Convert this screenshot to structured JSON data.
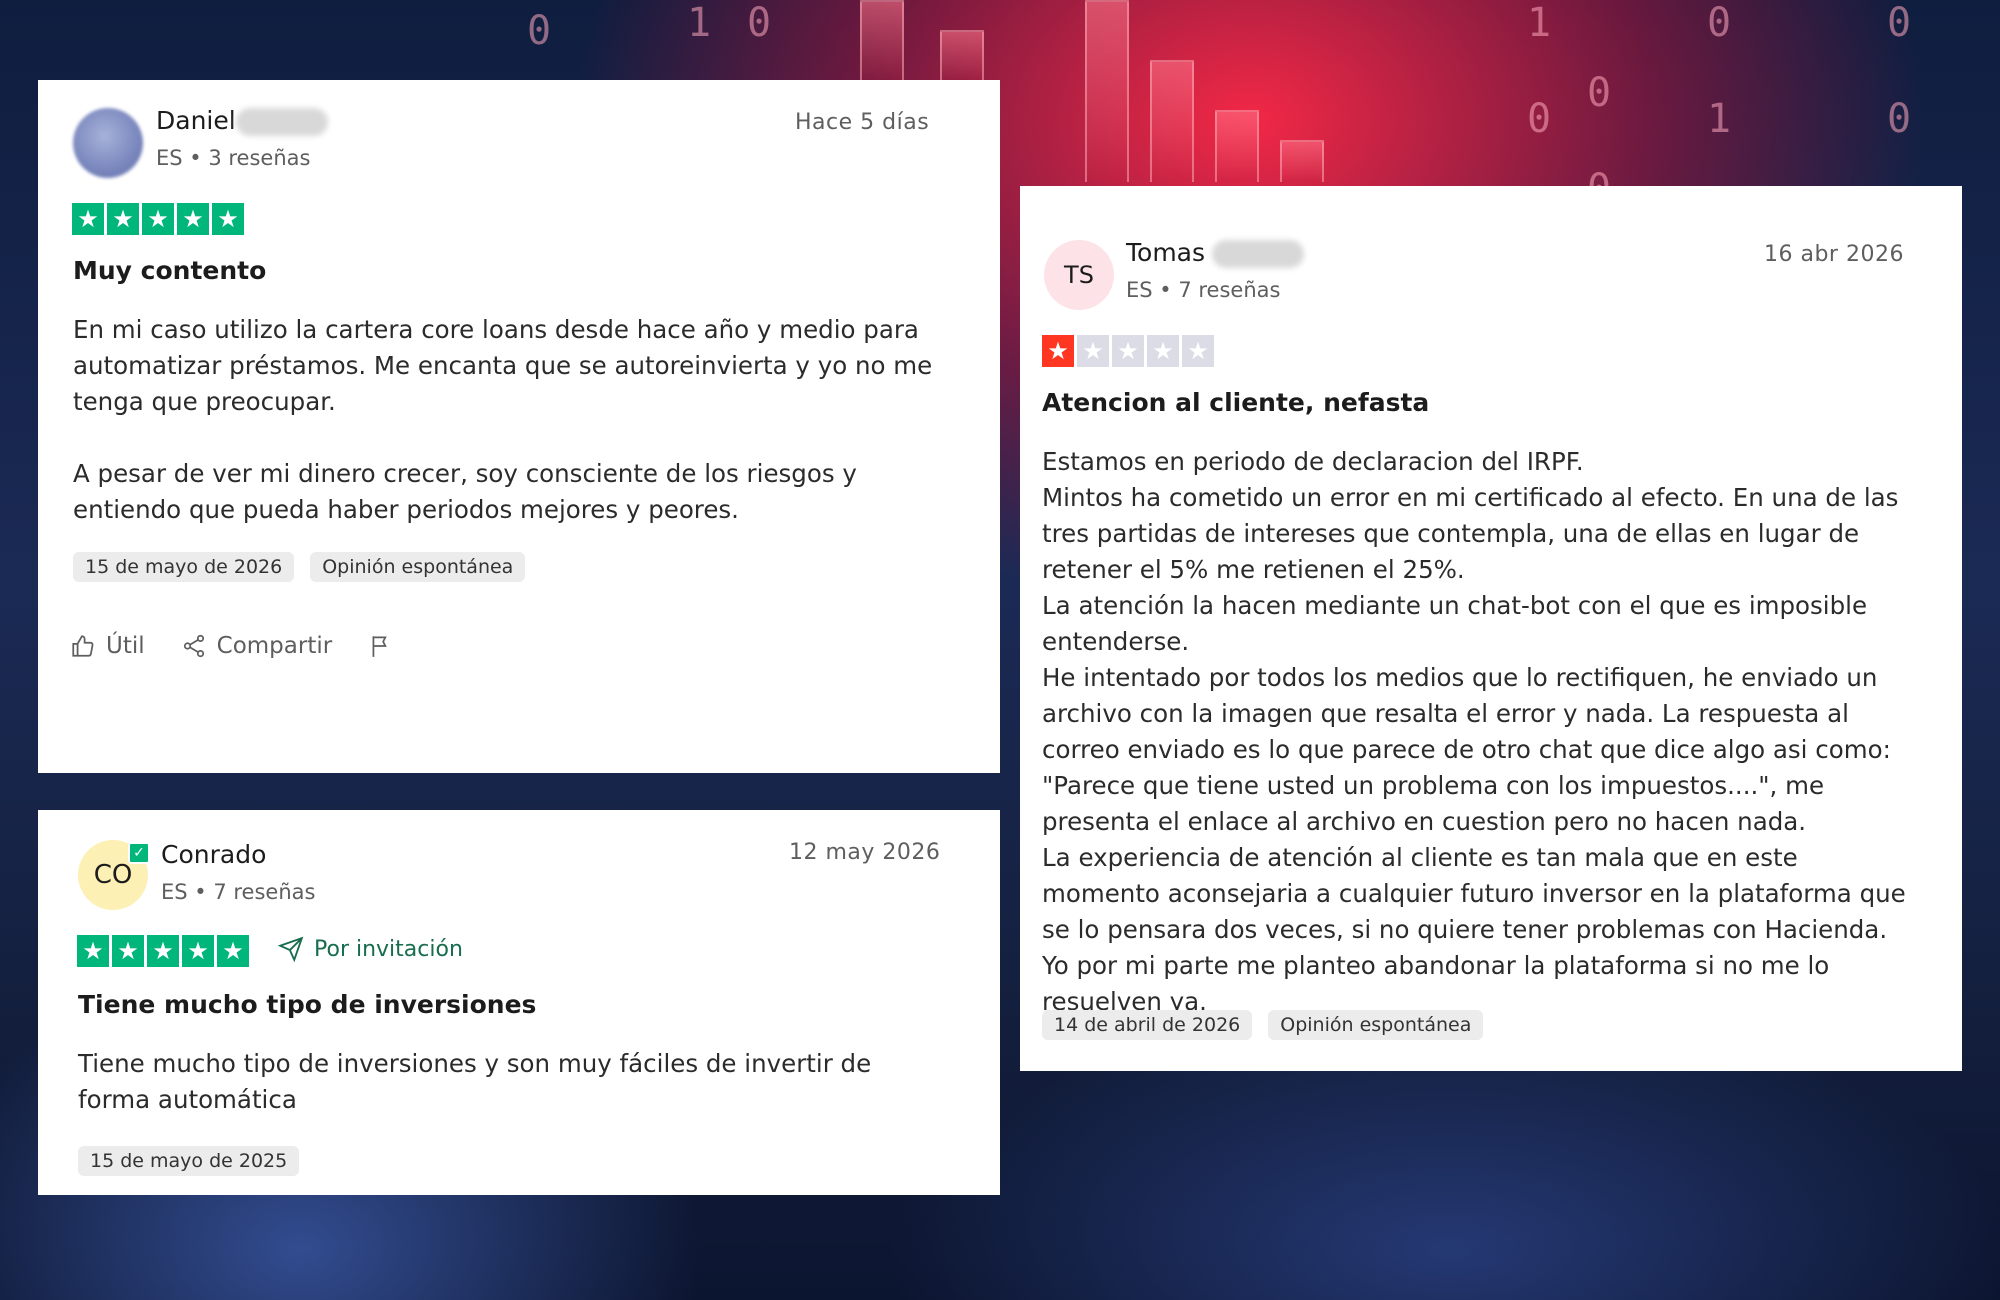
{
  "reviews": [
    {
      "name": "Daniel",
      "meta": "ES • 3 reseñas",
      "date": "Hace 5 días",
      "rating": 5,
      "title": "Muy contento",
      "body": [
        "En mi caso utilizo la cartera core loans desde hace año y medio para automatizar préstamos. Me encanta que se autoreinvierta y yo no me tenga que preocupar.",
        "A pesar de ver mi dinero crecer, soy consciente de los riesgos y entiendo que pueda haber periodos mejores y peores."
      ],
      "tags": [
        "15 de mayo de 2026",
        "Opinión espontánea"
      ],
      "actions": {
        "useful": "Útil",
        "share": "Compartir"
      }
    },
    {
      "initials": "CO",
      "name": "Conrado",
      "meta": "ES • 7 reseñas",
      "date": "12 may 2026",
      "rating": 5,
      "invite": "Por invitación",
      "title": "Tiene mucho tipo de inversiones",
      "body": "Tiene mucho tipo de inversiones y son muy fáciles de invertir de forma automática",
      "tags": [
        "15 de mayo de 2025"
      ]
    },
    {
      "initials": "TS",
      "name": "Tomas",
      "meta": "ES • 7 reseñas",
      "date": "16 abr 2026",
      "rating": 1,
      "title": "Atencion al cliente, nefasta",
      "body": [
        "Estamos en periodo de declaracion del IRPF.",
        "Mintos ha cometido un error en mi certificado al efecto. En una de las tres partidas de intereses que contempla, una de ellas en lugar de retener el 5% me retienen el 25%.",
        "La atención la hacen mediante un chat-bot con el que es imposible entenderse.",
        "He intentado por todos los medios que lo rectifiquen, he enviado un archivo con la imagen que resalta el error y nada. La respuesta al correo enviado es lo que parece de otro chat que dice algo asi como: \"Parece que tiene usted un problema con los impuestos....\", me presenta el enlace al archivo en cuestion pero no hacen nada.",
        "La experiencia de atención al cliente es tan mala que en este momento aconsejaria a cualquier futuro inversor en la plataforma que se lo pensara dos veces, si no quiere tener problemas con Hacienda. Yo por mi parte me planteo abandonar la plataforma si no me lo resuelven ya."
      ],
      "tags": [
        "14 de abril de 2026",
        "Opinión espontánea"
      ]
    }
  ],
  "background_digits": [
    "0 1",
    "1 0 1",
    "0 1 1",
    "1 0 1 0 1",
    "0 0 1",
    "0 1",
    "0 0 1 0 0"
  ],
  "colors": {
    "star_green": "#00b67a",
    "star_red": "#ff3722",
    "star_empty": "#dcdce6"
  }
}
